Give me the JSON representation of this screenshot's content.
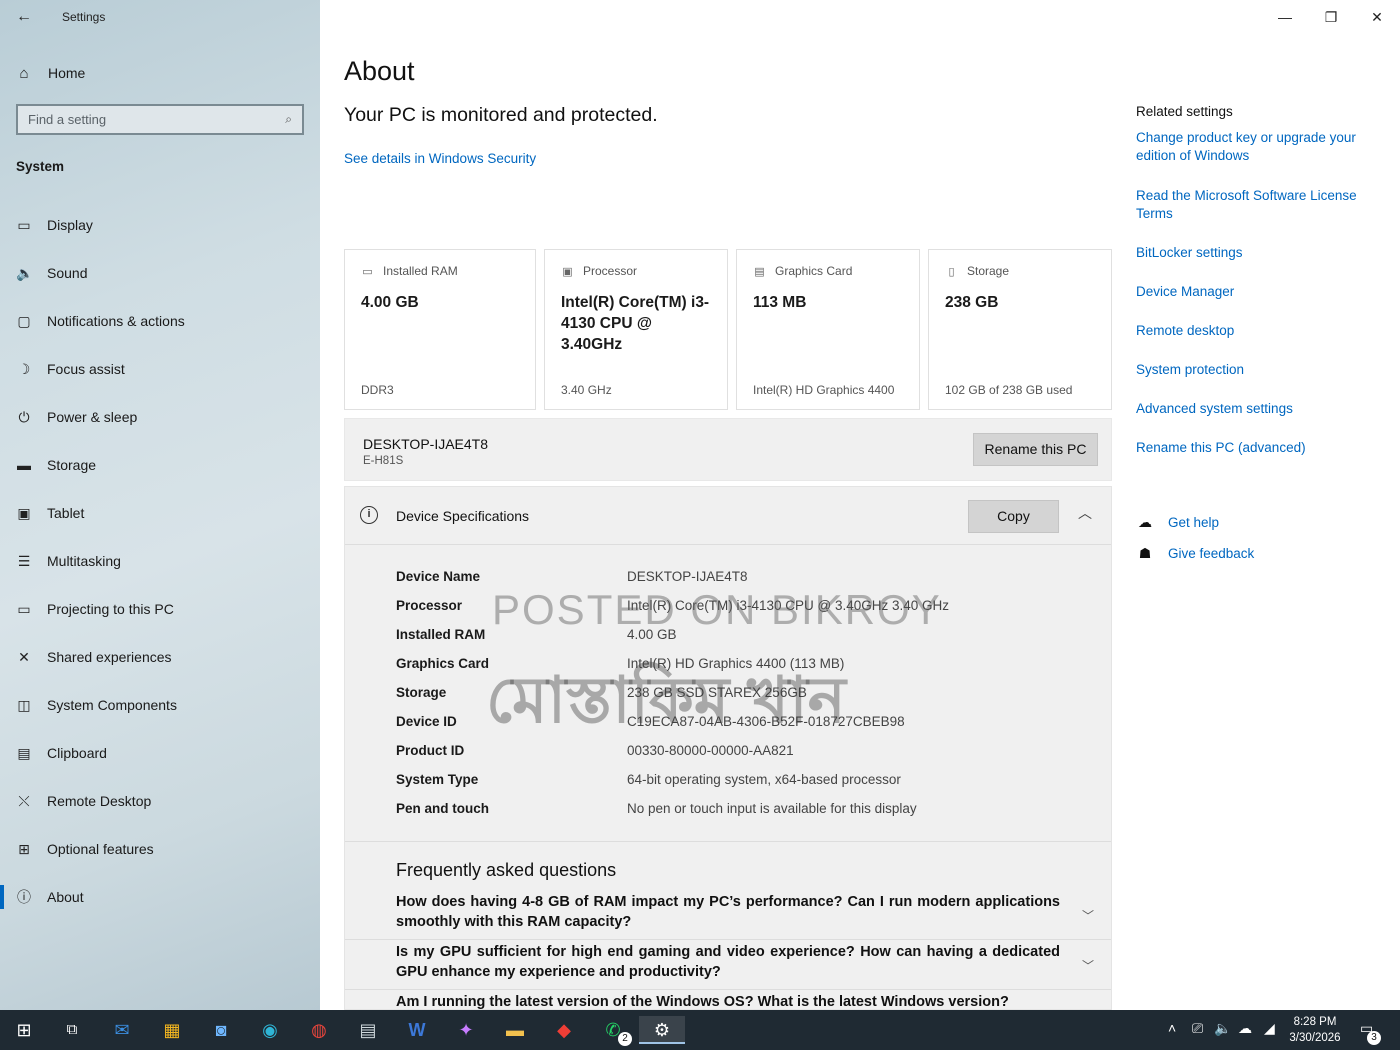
{
  "window": {
    "title": "Settings",
    "back": "←",
    "minimize": "—",
    "restore": "❐",
    "close": "✕"
  },
  "sidebar": {
    "home": "Home",
    "search_placeholder": "Find a setting",
    "section": "System",
    "items": [
      {
        "label": "Display",
        "icon": "▭"
      },
      {
        "label": "Sound",
        "icon": "🔈"
      },
      {
        "label": "Notifications & actions",
        "icon": "▢"
      },
      {
        "label": "Focus assist",
        "icon": "☽"
      },
      {
        "label": "Power & sleep",
        "icon": "⏻"
      },
      {
        "label": "Storage",
        "icon": "▬"
      },
      {
        "label": "Tablet",
        "icon": "▣"
      },
      {
        "label": "Multitasking",
        "icon": "☰"
      },
      {
        "label": "Projecting to this PC",
        "icon": "▭"
      },
      {
        "label": "Shared experiences",
        "icon": "✕"
      },
      {
        "label": "System Components",
        "icon": "◫"
      },
      {
        "label": "Clipboard",
        "icon": "▤"
      },
      {
        "label": "Remote Desktop",
        "icon": "⤬"
      },
      {
        "label": "Optional features",
        "icon": "⊞"
      },
      {
        "label": "About",
        "icon": "ⓘ"
      }
    ]
  },
  "main": {
    "title": "About",
    "protect_text": "Your PC is monitored and protected.",
    "security_link": "See details in Windows Security",
    "cards": [
      {
        "head": "Installed RAM",
        "value": "4.00 GB",
        "sub": "DDR3",
        "icon": "▭"
      },
      {
        "head": "Processor",
        "value": "Intel(R) Core(TM) i3-4130 CPU @ 3.40GHz",
        "sub": "3.40 GHz",
        "icon": "▣"
      },
      {
        "head": "Graphics Card",
        "value": "113 MB",
        "sub": "Intel(R) HD Graphics 4400",
        "icon": "▤"
      },
      {
        "head": "Storage",
        "value": "238 GB",
        "sub": "102 GB of 238 GB used",
        "icon": "▯"
      }
    ],
    "pc_name": "DESKTOP-IJAE4T8",
    "pc_model": "E-H81S",
    "rename_button": "Rename this PC",
    "spec_title": "Device Specifications",
    "copy_button": "Copy",
    "specs": [
      {
        "k": "Device Name",
        "v": "DESKTOP-IJAE4T8"
      },
      {
        "k": "Processor",
        "v": "Intel(R) Core(TM) i3-4130 CPU @ 3.40GHz   3.40 GHz"
      },
      {
        "k": "Installed RAM",
        "v": "4.00 GB"
      },
      {
        "k": "Graphics Card",
        "v": "Intel(R) HD Graphics 4400 (113 MB)"
      },
      {
        "k": "Storage",
        "v": "238 GB SSD STAREX 256GB"
      },
      {
        "k": "Device ID",
        "v": "C19ECA87-04AB-4306-B52F-018727CBEB98"
      },
      {
        "k": "Product ID",
        "v": "00330-80000-00000-AA821"
      },
      {
        "k": "System Type",
        "v": "64-bit operating system, x64-based processor"
      },
      {
        "k": "Pen and touch",
        "v": "No pen or touch input is available for this display"
      }
    ],
    "faq_title": "Frequently asked questions",
    "faqs": [
      "How does having 4-8 GB of RAM impact my PC’s performance? Can I run modern applications smoothly with this RAM capacity?",
      "Is my GPU sufficient for high end gaming and video experience? How can having a dedicated GPU enhance my experience and productivity?",
      "Am I running the latest version of the Windows OS? What is the latest Windows version?"
    ]
  },
  "related": {
    "header": "Related settings",
    "links": [
      "Change product key or upgrade your edition of Windows",
      "Read the Microsoft Software License Terms",
      "BitLocker settings",
      "Device Manager",
      "Remote desktop",
      "System protection",
      "Advanced system settings",
      "Rename this PC (advanced)"
    ],
    "get_help": "Get help",
    "give_feedback": "Give feedback"
  },
  "watermark": {
    "line1": "POSTED ON BIKROY",
    "line2": "মোস্তাকিম খান"
  },
  "taskbar": {
    "time": "8:28 PM",
    "date": "3/30/2026",
    "whatsapp_badge": "2",
    "notification_badge": "3",
    "icons": [
      "start",
      "task-view",
      "outlook",
      "store",
      "photos",
      "edge",
      "chrome",
      "calculator",
      "word",
      "copilot",
      "file-explorer",
      "anydesk",
      "whatsapp",
      "settings"
    ]
  }
}
